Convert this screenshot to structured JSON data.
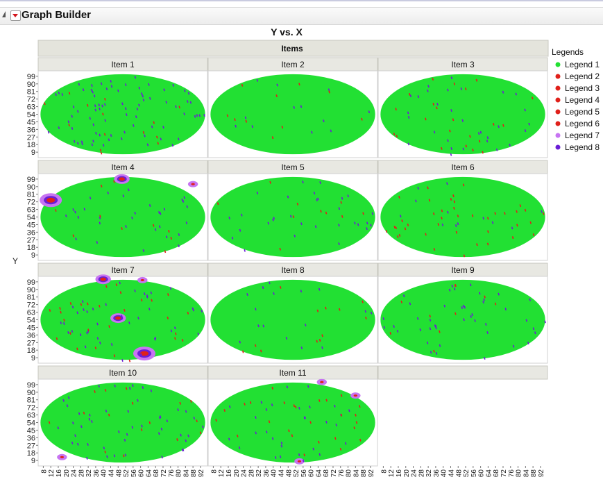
{
  "app": {
    "title": "Graph Builder"
  },
  "chart_data": {
    "type": "heatmap",
    "title": "Y vs. X",
    "xlabel": "",
    "ylabel": "Y",
    "group_label": "Items",
    "panels": [
      "Item 1",
      "Item 2",
      "Item 3",
      "Item 4",
      "Item 5",
      "Item 6",
      "Item 7",
      "Item 8",
      "Item 9",
      "Item 10",
      "Item 11"
    ],
    "layout": "4 rows x 3 columns, wrap",
    "x_ticks": [
      "8",
      "12",
      "16",
      "20",
      "24",
      "28",
      "32",
      "36",
      "40",
      "44",
      "48",
      "52",
      "56",
      "60",
      "64",
      "68",
      "72",
      "76",
      "80",
      "84",
      "88",
      "92"
    ],
    "y_ticks": [
      "99",
      "90",
      "81",
      "72",
      "63",
      "54",
      "45",
      "36",
      "27",
      "18",
      "9"
    ],
    "xlim": [
      6,
      95
    ],
    "ylim": [
      5,
      103
    ],
    "legend": {
      "title": "Legends",
      "position": "right",
      "entries": [
        {
          "name": "Legend 1",
          "color": "#22e033"
        },
        {
          "name": "Legend 2",
          "color": "#e0201a"
        },
        {
          "name": "Legend 3",
          "color": "#e0201a"
        },
        {
          "name": "Legend 4",
          "color": "#e0201a"
        },
        {
          "name": "Legend 5",
          "color": "#e0201a"
        },
        {
          "name": "Legend 6",
          "color": "#e0201a"
        },
        {
          "name": "Legend 7",
          "color": "#c774f2"
        },
        {
          "name": "Legend 8",
          "color": "#6a1ed6"
        }
      ]
    },
    "colors": {
      "background": "#22e033",
      "red": "#e0201a",
      "pink": "#c774f2",
      "purple": "#6a1ed6"
    },
    "hotspots": [
      {
        "panel": 4,
        "x": 12,
        "y": 74,
        "level": "high"
      },
      {
        "panel": 4,
        "x": 50,
        "y": 99,
        "level": "medium"
      },
      {
        "panel": 4,
        "x": 88,
        "y": 93,
        "level": "low"
      },
      {
        "panel": 7,
        "x": 40,
        "y": 102,
        "level": "medium"
      },
      {
        "panel": 7,
        "x": 48,
        "y": 56,
        "level": "medium"
      },
      {
        "panel": 7,
        "x": 62,
        "y": 14,
        "level": "high"
      },
      {
        "panel": 7,
        "x": 61,
        "y": 101,
        "level": "low"
      },
      {
        "panel": 10,
        "x": 18,
        "y": 13,
        "level": "low"
      },
      {
        "panel": 11,
        "x": 84,
        "y": 86,
        "level": "low"
      },
      {
        "panel": 11,
        "x": 54,
        "y": 8,
        "level": "low"
      },
      {
        "panel": 11,
        "x": 66,
        "y": 102,
        "level": "low"
      }
    ],
    "point_density": {
      "Item 1": [
        78,
        14
      ],
      "Item 2": [
        12,
        10
      ],
      "Item 3": [
        30,
        22
      ],
      "Item 4": [
        32,
        10
      ],
      "Item 5": [
        30,
        10
      ],
      "Item 6": [
        12,
        40
      ],
      "Item 7": [
        40,
        28
      ],
      "Item 8": [
        16,
        12
      ],
      "Item 9": [
        44,
        10
      ],
      "Item 10": [
        48,
        16
      ],
      "Item 11": [
        30,
        26
      ]
    },
    "grid": false
  }
}
